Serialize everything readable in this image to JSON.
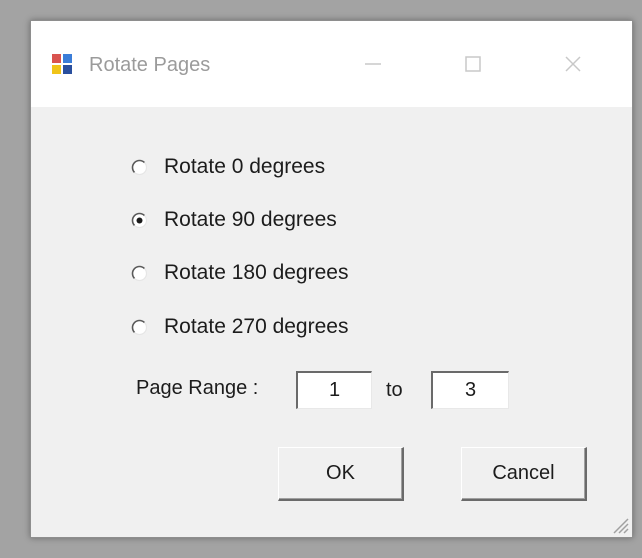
{
  "window": {
    "title": "Rotate Pages",
    "icons": {
      "app": "app-icon",
      "minimize": "minimize-icon",
      "maximize": "maximize-icon",
      "close": "close-icon",
      "grip": "resize-grip-icon"
    }
  },
  "rotation": {
    "options": [
      {
        "label": "Rotate 0 degrees",
        "selected": false
      },
      {
        "label": "Rotate 90 degrees",
        "selected": true
      },
      {
        "label": "Rotate 180 degrees",
        "selected": false
      },
      {
        "label": "Rotate 270 degrees",
        "selected": false
      }
    ]
  },
  "page_range": {
    "label": "Page Range :",
    "from_value": "1",
    "to_label": "to",
    "to_value": "3"
  },
  "buttons": {
    "ok": "OK",
    "cancel": "Cancel"
  }
}
